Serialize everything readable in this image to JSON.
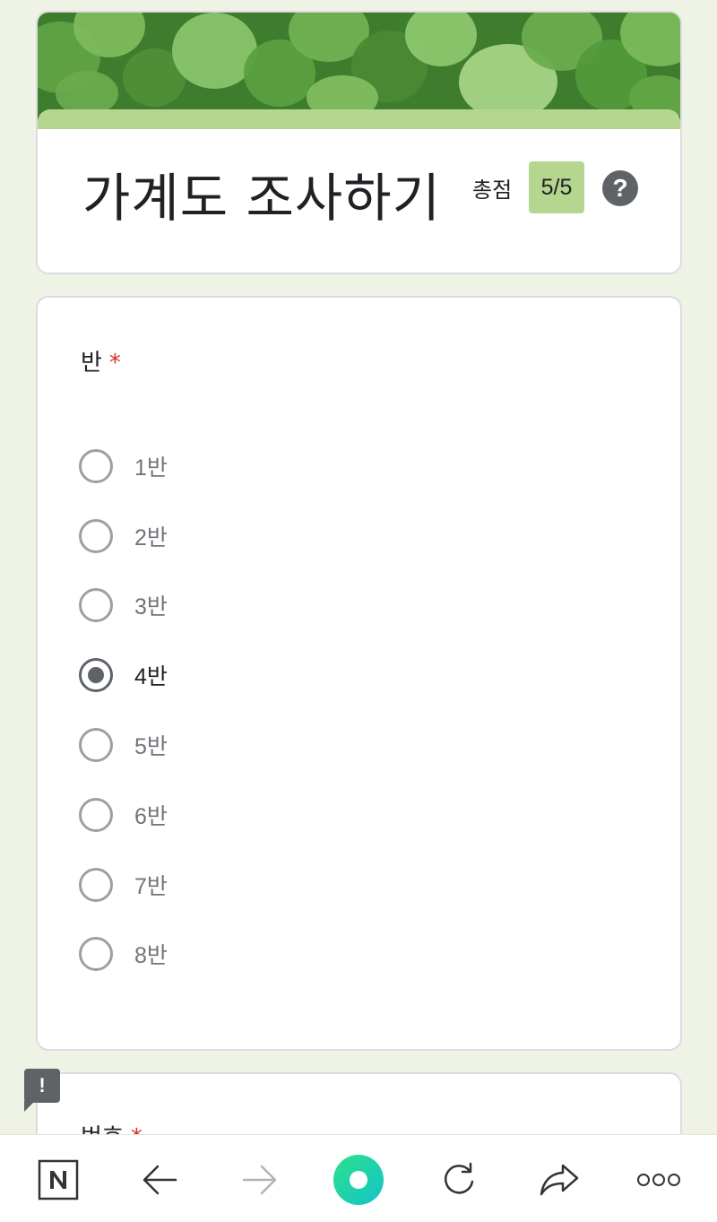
{
  "form": {
    "title": "가계도 조사하기",
    "score_label": "총점",
    "score_value": "5/5",
    "help_icon": "help-icon"
  },
  "question": {
    "title": "반",
    "required_mark": "*",
    "options": [
      {
        "label": "1반",
        "selected": false
      },
      {
        "label": "2반",
        "selected": false
      },
      {
        "label": "3반",
        "selected": false
      },
      {
        "label": "4반",
        "selected": true
      },
      {
        "label": "5반",
        "selected": false
      },
      {
        "label": "6반",
        "selected": false
      },
      {
        "label": "7반",
        "selected": false
      },
      {
        "label": "8반",
        "selected": false
      }
    ]
  },
  "next_question": {
    "title": "번호",
    "required_mark": "*"
  },
  "bottom_bar": {
    "icons": [
      "naver-home-icon",
      "back-arrow-icon",
      "forward-arrow-icon",
      "green-dot-icon",
      "refresh-icon",
      "share-icon",
      "more-icon"
    ]
  },
  "colors": {
    "accent": "#b5d68f",
    "page_bg": "#eef3e6",
    "required": "#d93025",
    "green_dot": "#1ed1a0"
  }
}
